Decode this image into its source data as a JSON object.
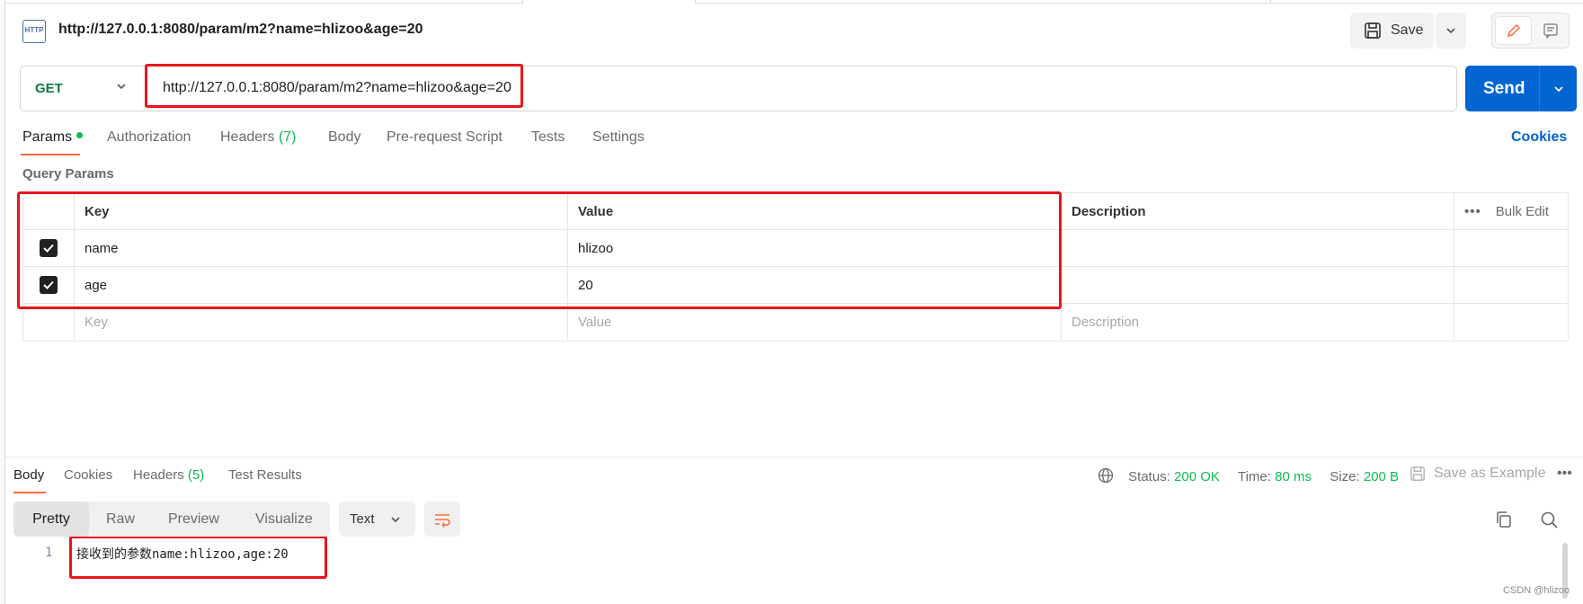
{
  "header": {
    "icon_label": "HTTP",
    "title": "http://127.0.0.1:8080/param/m2?name=hlizoo&age=20",
    "save_label": "Save"
  },
  "request": {
    "method": "GET",
    "url": "http://127.0.0.1:8080/param/m2?name=hlizoo&age=20",
    "send_label": "Send",
    "tabs": [
      {
        "label": "Params",
        "active": true
      },
      {
        "label": "Authorization"
      },
      {
        "label": "Headers",
        "count": "(7)"
      },
      {
        "label": "Body"
      },
      {
        "label": "Pre-request Script"
      },
      {
        "label": "Tests"
      },
      {
        "label": "Settings"
      }
    ],
    "cookies_label": "Cookies"
  },
  "query_params": {
    "title": "Query Params",
    "columns": {
      "key": "Key",
      "value": "Value",
      "description": "Description",
      "bulk_edit": "Bulk Edit"
    },
    "rows": [
      {
        "checked": true,
        "key": "name",
        "value": "hlizoo",
        "description": ""
      },
      {
        "checked": true,
        "key": "age",
        "value": "20",
        "description": ""
      }
    ],
    "placeholder": {
      "key": "Key",
      "value": "Value",
      "description": "Description"
    }
  },
  "response": {
    "tabs": [
      {
        "label": "Body",
        "active": true
      },
      {
        "label": "Cookies"
      },
      {
        "label": "Headers",
        "count": "(5)"
      },
      {
        "label": "Test Results"
      }
    ],
    "status_label": "Status:",
    "status_value": "200 OK",
    "time_label": "Time:",
    "time_value": "80 ms",
    "size_label": "Size:",
    "size_value": "200 B",
    "save_example_label": "Save as Example",
    "views": [
      "Pretty",
      "Raw",
      "Preview",
      "Visualize"
    ],
    "format": "Text",
    "line_number": "1",
    "body": "接收到的参数name:hlizoo,age:20"
  },
  "colors": {
    "accent_orange": "#ff6c37",
    "send_blue": "#0265d2",
    "method_green": "#0f7b3d",
    "status_green": "#0cbb52",
    "annotation_red": "#e8151b"
  },
  "watermark": "CSDN @hlizoo"
}
